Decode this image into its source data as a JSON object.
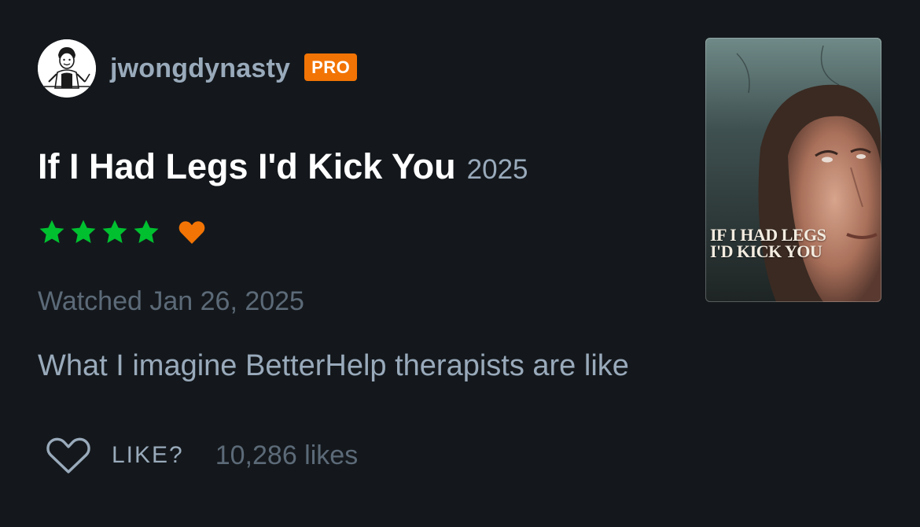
{
  "user": {
    "username": "jwongdynasty",
    "badge": "PRO",
    "avatar_icon": "avatar-cartoon-chef-icon"
  },
  "film": {
    "title": "If I Had Legs I'd Kick You",
    "year": "2025",
    "rating_stars": 4,
    "liked": true,
    "poster_title_line1": "IF I HAD LEGS",
    "poster_title_line2": "I'D KICK YOU"
  },
  "entry": {
    "watched": "Watched Jan 26, 2025",
    "review": "What I imagine BetterHelp therapists are like"
  },
  "like_bar": {
    "label": "LIKE?",
    "count": "10,286 likes"
  },
  "colors": {
    "background": "#14181c",
    "star_green": "#00c030",
    "heart_orange": "#f27405",
    "pro_badge": "#f27405",
    "muted_text": "#99aabb",
    "dim_text": "#5c6a78"
  }
}
